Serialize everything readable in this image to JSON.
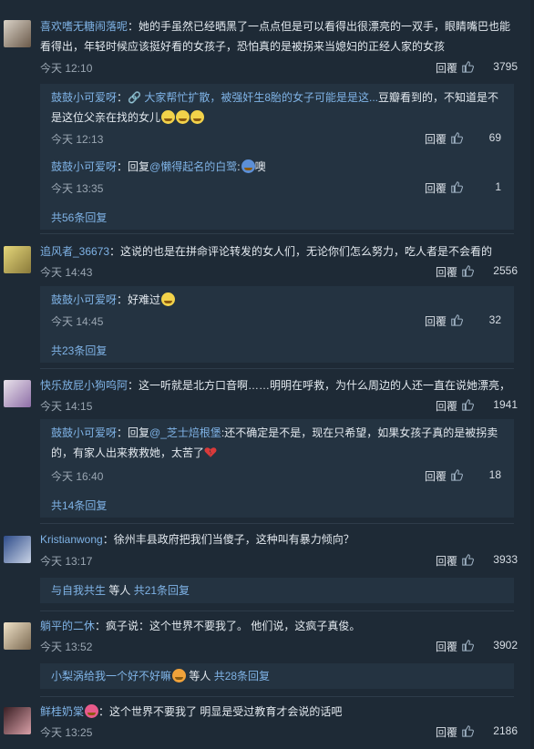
{
  "actions": {
    "reply_label": "回覆"
  },
  "comments": [
    {
      "user": "喜欢嗜无糖闹落呢",
      "text": "：她的手虽然已经晒黑了一点点但是可以看得出很漂亮的一双手，眼睛嘴巴也能看得出，年轻时候应该挺好看的女孩子，恐怕真的是被拐来当媳妇的正经人家的女孩",
      "time": "今天 12:10",
      "likes": "3795",
      "replies": [
        {
          "user": "鼓鼓小可爱呀",
          "link": "大家帮忙扩散，被强奸生8胎的女子可能是是这...",
          "text": "豆瓣看到的，不知道是不是这位父亲在找的女儿",
          "time": "今天 12:13",
          "likes": "69"
        },
        {
          "user": "鼓鼓小可爱呀",
          "reply_prefix": "：回复",
          "mention": "@懒得起名的白鹭",
          "text": "噢",
          "time": "今天 13:35",
          "likes": "1"
        }
      ],
      "more": "共56条回复"
    },
    {
      "user": "追风者_36673",
      "text": "：这说的也是在拼命评论转发的女人们，无论你们怎么努力，吃人者是不会看的",
      "time": "今天 14:43",
      "likes": "2556",
      "replies": [
        {
          "user": "鼓鼓小可爱呀",
          "text": "：好难过",
          "time": "今天 14:45",
          "likes": "32"
        }
      ],
      "more": "共23条回复"
    },
    {
      "user": "快乐放屁小狗呜阿",
      "text": "：这一听就是北方口音啊……明明在呼救，为什么周边的人还一直在说她漂亮，",
      "time": "今天 14:15",
      "likes": "1941",
      "replies": [
        {
          "user": "鼓鼓小可爱呀",
          "reply_prefix": "：回复",
          "mention": "@_芝士焙根堡",
          "text": ":还不确定是不是，现在只希望，如果女孩子真的是被拐卖的，有家人出来救救她，太苦了",
          "time": "今天 16:40",
          "likes": "18"
        }
      ],
      "more": "共14条回复"
    },
    {
      "user": "Kristianwong",
      "text": "：徐州丰县政府把我们当傻子，这种叫有暴力倾向？",
      "time": "今天 13:17",
      "likes": "3933",
      "bar": {
        "users": "与自我共生",
        "mid": " 等人 ",
        "count": "共21条回复"
      }
    },
    {
      "user": "躺平的二休",
      "text": "：疯子说：这个世界不要我了。 他们说，这疯子真俊。",
      "time": "今天 13:52",
      "likes": "3902",
      "bar": {
        "users": "小梨涡给我一个好不好嘛",
        "mid": " 等人 ",
        "count": "共28条回复"
      }
    },
    {
      "user": "鲜桂奶棠",
      "text": "：这个世界不要我了 明显是受过教育才会说的话吧",
      "time": "今天 13:25",
      "likes": "2186"
    }
  ]
}
